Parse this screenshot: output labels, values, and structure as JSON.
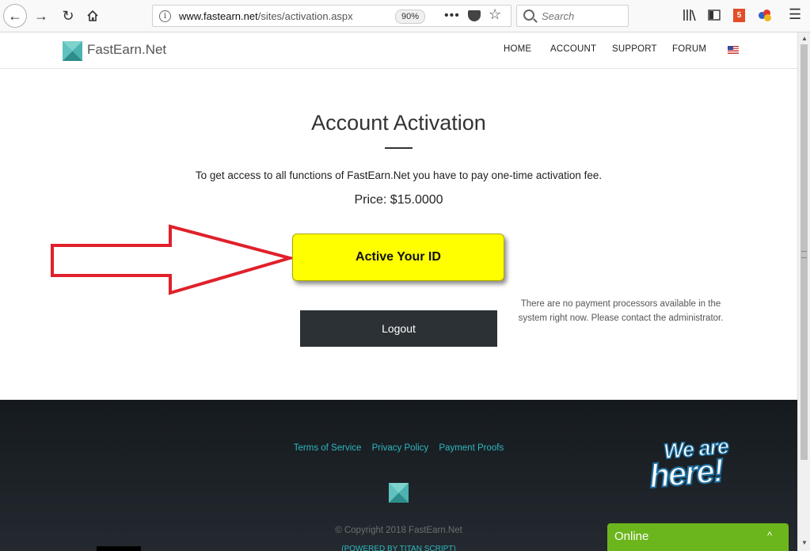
{
  "browser": {
    "url_domain": "www.fastearn.net",
    "url_path": "/sites/activation.aspx",
    "zoom": "90%",
    "search_placeholder": "Search",
    "page_actions": "•••",
    "menu_icon": "hamburger-icon"
  },
  "site": {
    "logo_text": "FastEarn.Net",
    "nav": [
      "HOME",
      "ACCOUNT",
      "SUPPORT",
      "FORUM"
    ]
  },
  "main": {
    "title": "Account Activation",
    "description": "To get access to all functions of FastEarn.Net you have to pay one-time activation fee.",
    "price": "Price: $15.0000",
    "activate_label": "Active Your ID",
    "logout_label": "Logout",
    "note": "There are no payment processors available in the system right now. Please contact the administrator."
  },
  "footer": {
    "links": [
      "Terms of Service",
      "Privacy Policy",
      "Payment Proofs"
    ],
    "copyright": "© Copyright 2018 FastEarn.Net",
    "powered": "(POWERED BY TITAN SCRIPT)"
  },
  "chat": {
    "badge_line1": "We are",
    "badge_line2": "here!",
    "status": "Online"
  },
  "colors": {
    "accent_link": "#2fb7c0",
    "activate_bg": "#ffff00",
    "logout_bg": "#2c3136",
    "arrow": "#e0202a",
    "online_bg": "#6cb61d"
  }
}
